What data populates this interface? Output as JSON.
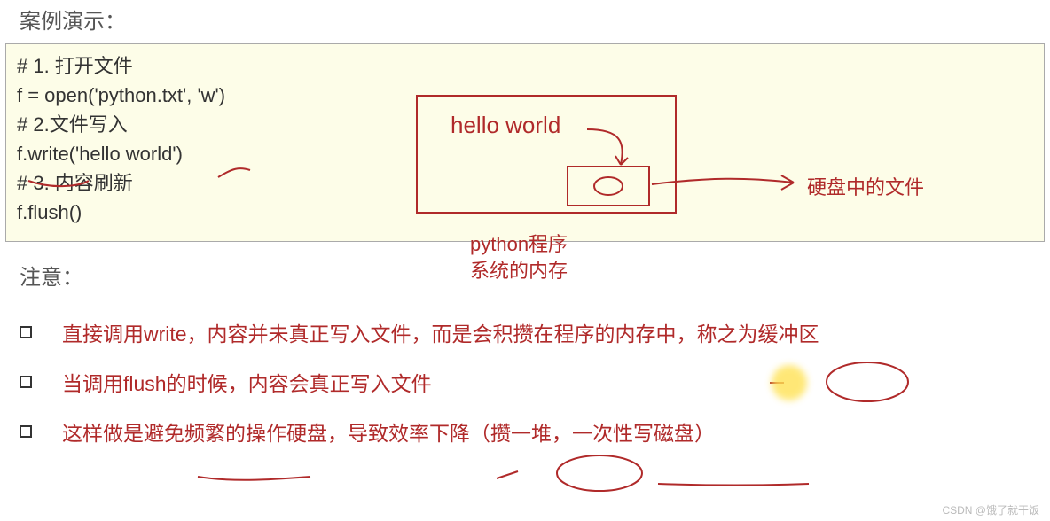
{
  "heading": "案例演示：",
  "code": {
    "l1": "# 1. 打开文件",
    "l2": "f = open('python.txt', 'w')",
    "l3": "",
    "l4": "# 2.文件写入",
    "l5": "f.write('hello world')",
    "l6": "",
    "l7": "# 3. 内容刷新",
    "l8": "f.flush()"
  },
  "diagram": {
    "hello": "hello world",
    "mem1": "python程序",
    "mem2": "系统的内存",
    "disk": "硬盘中的文件"
  },
  "note_heading": "注意：",
  "bullets": {
    "b1": "直接调用write，内容并未真正写入文件，而是会积攒在程序的内存中，称之为缓冲区",
    "b2": "当调用flush的时候，内容会真正写入文件",
    "b3": "这样做是避免频繁的操作硬盘，导致效率下降（攒一堆，一次性写磁盘）"
  },
  "watermark": "CSDN @饿了就干饭"
}
